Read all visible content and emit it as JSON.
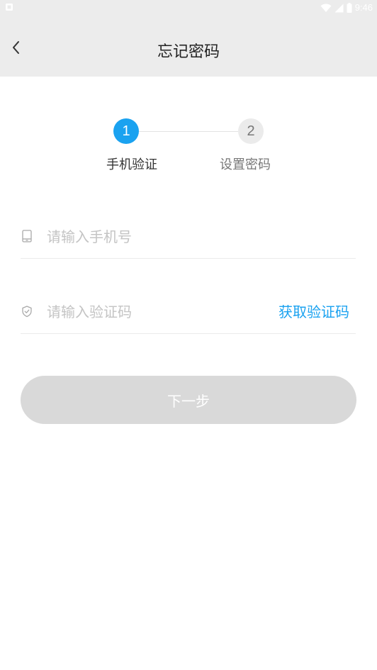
{
  "status_bar": {
    "time": "9:46",
    "notification_icon": "notification-icon",
    "wifi_icon": "wifi-icon",
    "signal_icon": "signal-icon",
    "battery_icon": "battery-icon"
  },
  "header": {
    "title": "忘记密码",
    "back_icon": "chevron-left-icon",
    "background": "#ececec"
  },
  "stepper": {
    "current_step": 1,
    "steps": [
      {
        "number": "1",
        "label": "手机验证",
        "active": true
      },
      {
        "number": "2",
        "label": "设置密码",
        "active": false
      }
    ]
  },
  "form": {
    "phone": {
      "value": "",
      "placeholder": "请输入手机号",
      "icon": "phone-icon"
    },
    "code": {
      "value": "",
      "placeholder": "请输入验证码",
      "icon": "shield-icon"
    },
    "get_code_label": "获取验证码"
  },
  "next_button": {
    "label": "下一步",
    "enabled": false
  },
  "colors": {
    "accent": "#1aa2f0",
    "disabled_button": "#d9d9d9",
    "placeholder": "#c4c4c4"
  }
}
